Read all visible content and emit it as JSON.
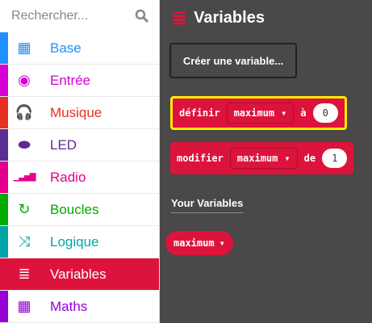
{
  "search": {
    "placeholder": "Rechercher...",
    "icon": "search-icon"
  },
  "categories": [
    {
      "label": "Base",
      "color": "#1E90FF",
      "icon": "grid-icon",
      "glyph": "▦"
    },
    {
      "label": "Entrée",
      "color": "#D400D4",
      "icon": "target-icon",
      "glyph": "◉"
    },
    {
      "label": "Musique",
      "color": "#E63022",
      "icon": "headphones-icon",
      "glyph": "🎧"
    },
    {
      "label": "LED",
      "color": "#5C2D91",
      "icon": "toggle-icon",
      "glyph": "⬬"
    },
    {
      "label": "Radio",
      "color": "#E3008C",
      "icon": "signal-icon",
      "glyph": "▁▃▅▇"
    },
    {
      "label": "Boucles",
      "color": "#00AA00",
      "icon": "refresh-icon",
      "glyph": "↻"
    },
    {
      "label": "Logique",
      "color": "#00A4A6",
      "icon": "shuffle-icon",
      "glyph": "⤨"
    },
    {
      "label": "Variables",
      "color": "#DC143C",
      "icon": "list-icon",
      "glyph": "≣",
      "selected": true
    },
    {
      "label": "Maths",
      "color": "#9400D3",
      "icon": "calculator-icon",
      "glyph": "▦"
    }
  ],
  "flyout": {
    "title": "Variables",
    "create_button": "Créer une variable...",
    "set_block": {
      "keyword": "définir",
      "variable": "maximum",
      "to": "à",
      "value": "0"
    },
    "change_block": {
      "keyword": "modifier",
      "variable": "maximum",
      "by": "de",
      "value": "1"
    },
    "your_variables": "Your Variables",
    "variable": "maximum"
  }
}
